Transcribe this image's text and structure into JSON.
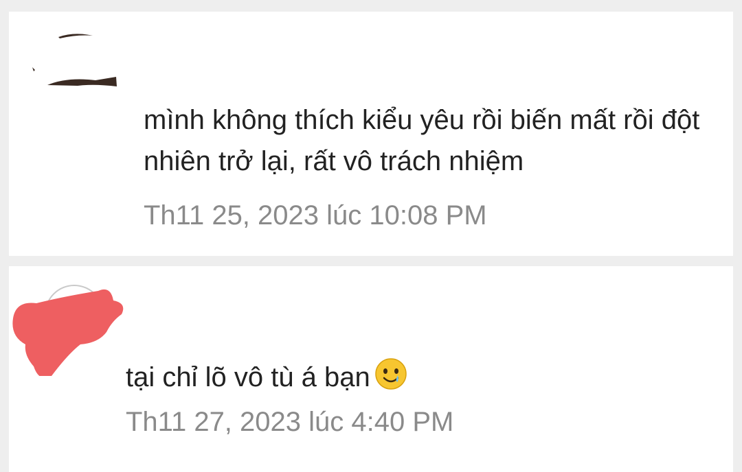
{
  "comments": [
    {
      "text": "mình không thích kiểu yêu rồi biến mất rồi đột nhiên trở lại, rất vô trách nhiệm",
      "timestamp": "Th11 25, 2023 lúc 10:08 PM"
    },
    {
      "text": "tại chỉ lõ vô tù á bạn",
      "emoji": "smiling-face-with-tear-icon",
      "timestamp": "Th11 27, 2023 lúc 4:40 PM"
    }
  ],
  "colors": {
    "background": "#eeeeee",
    "card": "#ffffff",
    "text": "#222222",
    "timestamp": "#8a8a8a",
    "redaction": "#ee5f61",
    "emoji_face": "#f7c630"
  }
}
